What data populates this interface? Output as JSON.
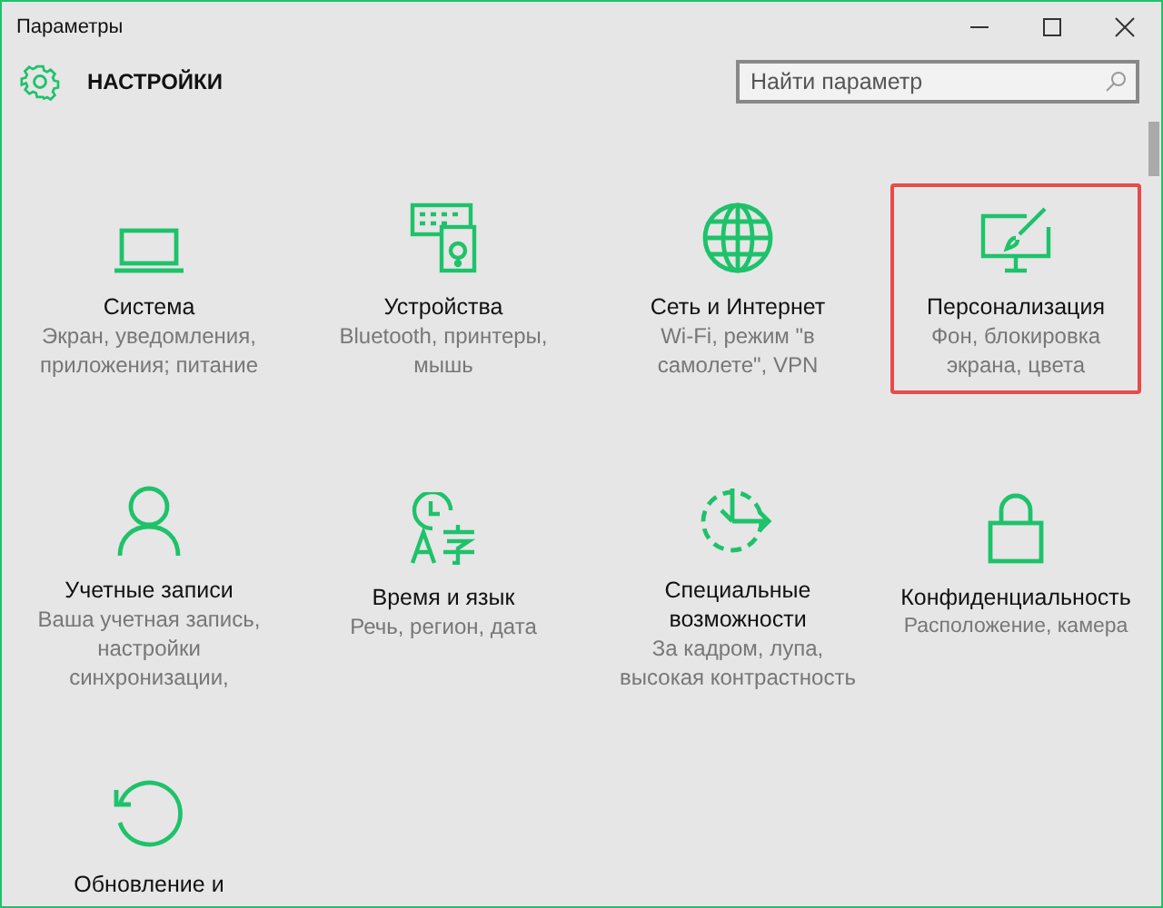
{
  "window": {
    "title": "Параметры"
  },
  "header": {
    "title": "НАСТРОЙКИ"
  },
  "search": {
    "placeholder": "Найти параметр"
  },
  "tiles": [
    {
      "title": "Система",
      "description": "Экран, уведомления, приложения; питание",
      "selected": false
    },
    {
      "title": "Устройства",
      "description": "Bluetooth, принтеры, мышь",
      "selected": false
    },
    {
      "title": "Сеть и Интернет",
      "description": "Wi-Fi, режим \"в самолете\", VPN",
      "selected": false
    },
    {
      "title": "Персонализация",
      "description": "Фон, блокировка экрана, цвета",
      "selected": true
    },
    {
      "title": "Учетные записи",
      "description": "Ваша учетная запись, настройки синхронизации,",
      "selected": false
    },
    {
      "title": "Время и язык",
      "description": "Речь, регион, дата",
      "selected": false
    },
    {
      "title": "Специальные возможности",
      "description": "За кадром, лупа, высокая контрастность",
      "selected": false
    },
    {
      "title": "Конфиденциальность",
      "description": "Расположение, камера",
      "selected": false
    },
    {
      "title": "Обновление и",
      "selected": false
    }
  ]
}
